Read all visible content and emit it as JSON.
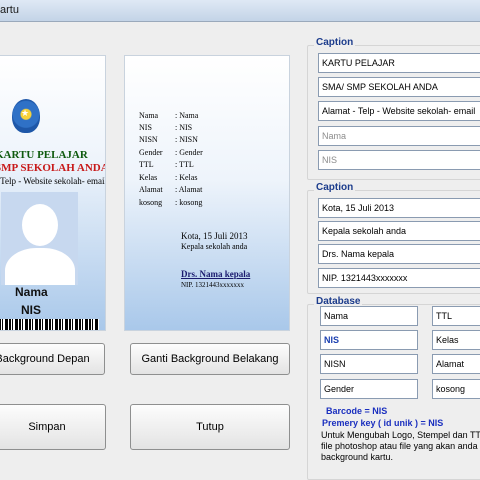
{
  "window": {
    "title": "artu"
  },
  "front_card": {
    "title": "KARTU PELAJAR",
    "school": "SMP SEKOLAH ANDA",
    "contact": "- Telp - Website sekolah- email",
    "nama": "Nama",
    "nis": "NIS"
  },
  "back_card": {
    "fields": [
      {
        "label": "Nama",
        "value": ": Nama"
      },
      {
        "label": "NIS",
        "value": ": NIS"
      },
      {
        "label": "NISN",
        "value": ": NISN"
      },
      {
        "label": "Gender",
        "value": ": Gender"
      },
      {
        "label": "TTL",
        "value": ": TTL"
      },
      {
        "label": "Kelas",
        "value": ": Kelas"
      },
      {
        "label": "Alamat",
        "value": ": Alamat"
      },
      {
        "label": "kosong",
        "value": ": kosong"
      }
    ],
    "kota": "Kota, 15 Juli 2013",
    "kepala": "Kepala sekolah anda",
    "drs": "Drs. Nama kepala",
    "nip": "NIP. 1321443xxxxxxx"
  },
  "buttons": {
    "bg_front": "Background Depan",
    "bg_back": "Ganti Background Belakang",
    "save": "Simpan",
    "close": "Tutup"
  },
  "caption1": {
    "legend": "Caption",
    "fields": [
      "KARTU PELAJAR",
      "SMA/ SMP SEKOLAH ANDA",
      "Alamat - Telp - Website sekolah- email",
      "Nama",
      "NIS"
    ]
  },
  "caption2": {
    "legend": "Caption",
    "fields": [
      "Kota, 15 Juli 2013",
      "Kepala sekolah anda",
      "Drs. Nama kepala",
      "NIP. 1321443xxxxxxx"
    ]
  },
  "database": {
    "legend": "Database",
    "fields": [
      "Nama",
      "TTL",
      "NIS",
      "Kelas",
      "NISN",
      "Alamat",
      "Gender",
      "kosong"
    ],
    "barcode_label": "Barcode = NIS",
    "primary_key_label": "Premery key ( id unik ) = NIS",
    "note_lines": [
      "Untuk Mengubah Logo, Stempel dan TTD b",
      "file photoshop atau file yang akan anda gun",
      "background kartu."
    ]
  }
}
